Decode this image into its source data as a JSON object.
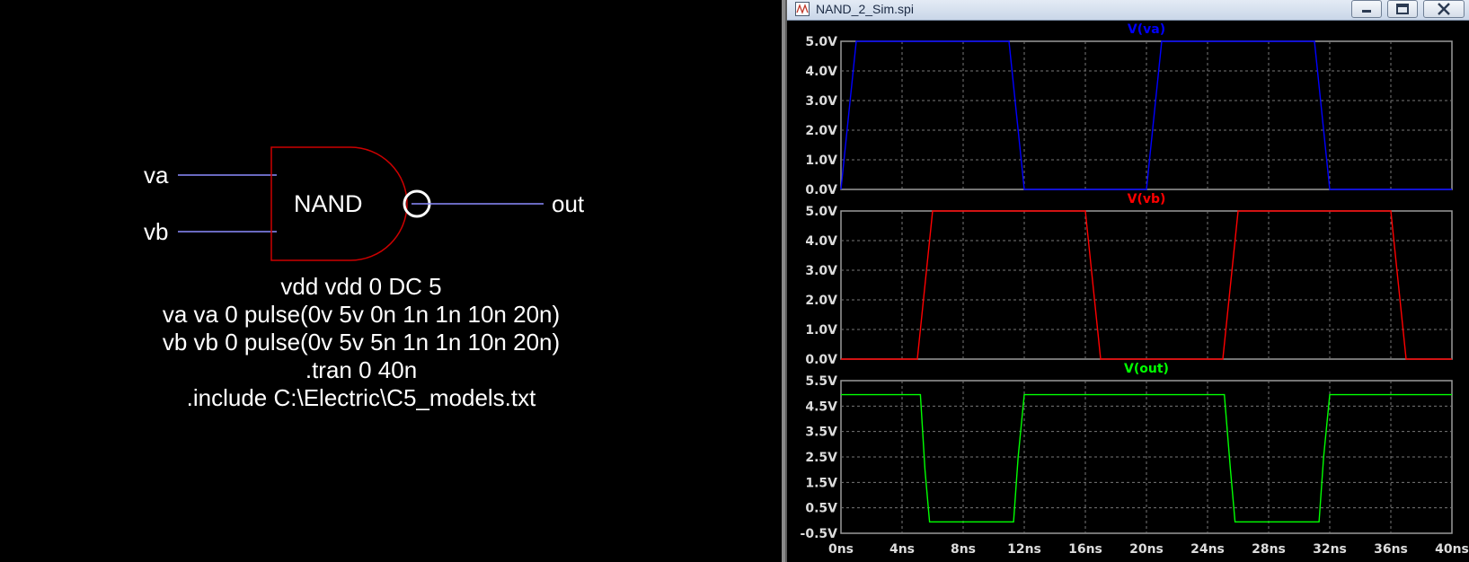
{
  "schematic": {
    "gate_label": "NAND",
    "inputs": [
      "va",
      "vb"
    ],
    "output": "out",
    "spice_lines": [
      "vdd vdd 0 DC 5",
      "va va 0 pulse(0v 5v 0n 1n 1n 10n 20n)",
      "vb vb 0 pulse(0v 5v 5n 1n 1n 10n 20n)",
      ".tran 0 40n",
      ".include C:\\Electric\\C5_models.txt"
    ],
    "colors": {
      "gate": "#cc0000",
      "wire": "#8c8cff",
      "text": "#ffffff",
      "bubble": "#ffffff"
    }
  },
  "window": {
    "title": "NAND_2_Sim.spi",
    "title_icon": "waveform-app-icon",
    "buttons": {
      "minimize": "minimize-icon",
      "maximize": "maximize-icon",
      "close": "close-icon"
    }
  },
  "chart_data": [
    {
      "type": "line",
      "title": "V(va)",
      "title_color": "#0000ff",
      "x": [
        0,
        1,
        11,
        12,
        20,
        21,
        31,
        32,
        40
      ],
      "series": [
        {
          "values": [
            0,
            5,
            5,
            0,
            0,
            5,
            5,
            0,
            0
          ],
          "color": "#0000ff"
        }
      ],
      "y_ticks": [
        "5.0V",
        "4.0V",
        "3.0V",
        "2.0V",
        "1.0V",
        "0.0V"
      ],
      "ylim": [
        0,
        5
      ],
      "xlim": [
        0,
        40
      ],
      "grid": true
    },
    {
      "type": "line",
      "title": "V(vb)",
      "title_color": "#ff0000",
      "x": [
        0,
        5,
        6,
        16,
        17,
        25,
        26,
        36,
        37,
        40
      ],
      "series": [
        {
          "values": [
            0,
            0,
            5,
            5,
            0,
            0,
            5,
            5,
            0,
            0
          ],
          "color": "#ff0000"
        }
      ],
      "y_ticks": [
        "5.0V",
        "4.0V",
        "3.0V",
        "2.0V",
        "1.0V",
        "0.0V"
      ],
      "ylim": [
        0,
        5
      ],
      "xlim": [
        0,
        40
      ],
      "grid": true
    },
    {
      "type": "line",
      "title": "V(out)",
      "title_color": "#00ff00",
      "x": [
        0,
        5.2,
        5.5,
        5.8,
        11.3,
        11.6,
        12,
        25.1,
        25.5,
        25.8,
        31.3,
        31.6,
        32,
        40
      ],
      "series": [
        {
          "values": [
            4.95,
            4.95,
            2.0,
            -0.05,
            -0.05,
            2.5,
            4.95,
            4.95,
            2.0,
            -0.05,
            -0.05,
            2.5,
            4.95,
            4.95
          ],
          "color": "#00ff00"
        }
      ],
      "y_ticks": [
        "5.5V",
        "4.5V",
        "3.5V",
        "2.5V",
        "1.5V",
        "0.5V",
        "-0.5V"
      ],
      "ylim": [
        -0.5,
        5.5
      ],
      "xlim": [
        0,
        40
      ],
      "x_ticks": [
        "0ns",
        "4ns",
        "8ns",
        "12ns",
        "16ns",
        "20ns",
        "24ns",
        "28ns",
        "32ns",
        "36ns",
        "40ns"
      ],
      "grid": true
    }
  ]
}
